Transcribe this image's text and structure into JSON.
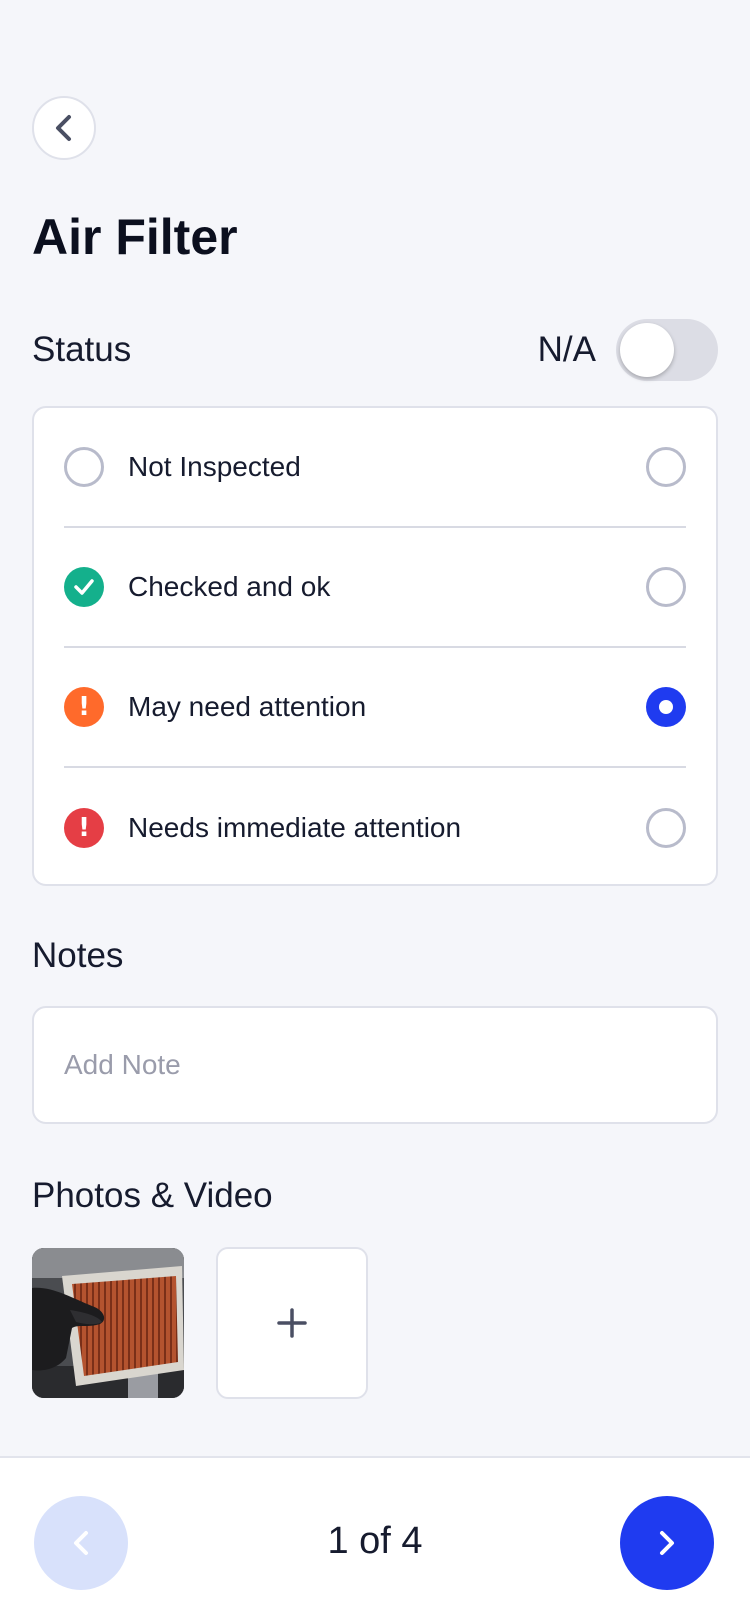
{
  "header": {
    "back_icon": "chevron-left-icon",
    "title": "Air Filter"
  },
  "status": {
    "label": "Status",
    "na_label": "N/A",
    "na_enabled": false,
    "options": [
      {
        "label": "Not Inspected",
        "icon": "empty-circle-icon",
        "selected": false
      },
      {
        "label": "Checked and ok",
        "icon": "check-circle-icon",
        "color": "#14b08c",
        "selected": false
      },
      {
        "label": "May need attention",
        "icon": "exclamation-circle-icon",
        "color": "#ff6a2b",
        "selected": true
      },
      {
        "label": "Needs immediate attention",
        "icon": "exclamation-circle-icon",
        "color": "#e53e45",
        "selected": false
      }
    ]
  },
  "notes": {
    "label": "Notes",
    "placeholder": "Add Note",
    "value": ""
  },
  "media": {
    "label": "Photos & Video",
    "add_icon": "plus-icon",
    "items": [
      {
        "description": "air filter photo"
      }
    ]
  },
  "footer": {
    "pager_text": "1 of 4",
    "prev_icon": "chevron-left-icon",
    "next_icon": "chevron-right-icon",
    "accent_color": "#1f3bf0"
  }
}
